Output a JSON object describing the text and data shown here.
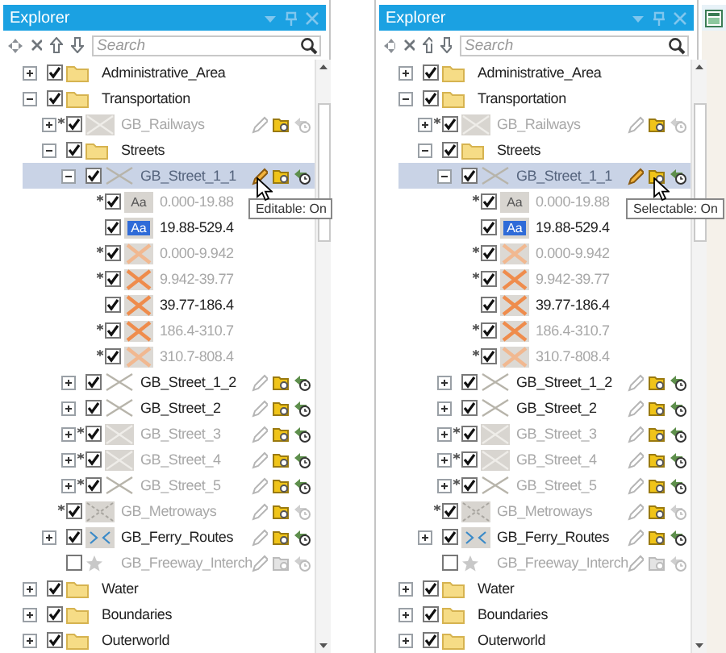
{
  "panels": [
    {
      "title": "Explorer",
      "search": {
        "placeholder": "Search"
      },
      "tooltip": "Editable: On",
      "items": [
        {
          "label": "Administrative_Area",
          "kind": "folder",
          "checked": true,
          "expanded": false
        },
        {
          "label": "Transportation",
          "kind": "folder",
          "checked": true,
          "expanded": true,
          "children": [
            {
              "label": "GB_Railways",
              "kind": "line-box",
              "checked": true,
              "expanded": false,
              "modified": true,
              "dimmed": true,
              "tools": [
                {
                  "kind": "edit",
                  "on": false
                },
                {
                  "kind": "select",
                  "on": true
                },
                {
                  "kind": "snap",
                  "on": false
                }
              ]
            },
            {
              "label": "Streets",
              "kind": "folder",
              "checked": true,
              "expanded": true,
              "children": [
                {
                  "label": "GB_Street_1_1",
                  "kind": "line",
                  "checked": true,
                  "expanded": true,
                  "dimmed": true,
                  "selected": true,
                  "tools": [
                    {
                      "kind": "edit",
                      "on": true,
                      "hovered": true
                    },
                    {
                      "kind": "select",
                      "on": true,
                      "hovered": false
                    },
                    {
                      "kind": "snap",
                      "on": true,
                      "hovered": false
                    }
                  ],
                  "children": [
                    {
                      "label": "0.000-19.88",
                      "kind": "text-grey",
                      "swatch": "Aa",
                      "checked": true,
                      "modified": true,
                      "dimmed": true
                    },
                    {
                      "label": "19.88-529.4",
                      "kind": "text-blue",
                      "swatch": "Aa",
                      "checked": true
                    },
                    {
                      "label": "0.000-9.942",
                      "kind": "x-pale",
                      "checked": true,
                      "modified": true,
                      "dimmed": true
                    },
                    {
                      "label": "9.942-39.77",
                      "kind": "x-orange",
                      "checked": true,
                      "modified": true,
                      "dimmed": true
                    },
                    {
                      "label": "39.77-186.4",
                      "kind": "x-orange",
                      "checked": true
                    },
                    {
                      "label": "186.4-310.7",
                      "kind": "x-orange",
                      "checked": true,
                      "modified": true,
                      "dimmed": true
                    },
                    {
                      "label": "310.7-808.4",
                      "kind": "x-pale",
                      "checked": true,
                      "modified": true,
                      "dimmed": true
                    }
                  ]
                },
                {
                  "label": "GB_Street_1_2",
                  "kind": "line",
                  "checked": true,
                  "expanded": false,
                  "tools": [
                    {
                      "kind": "edit",
                      "on": false
                    },
                    {
                      "kind": "select",
                      "on": true
                    },
                    {
                      "kind": "snap",
                      "on": true
                    }
                  ]
                },
                {
                  "label": "GB_Street_2",
                  "kind": "line",
                  "checked": true,
                  "expanded": false,
                  "tools": [
                    {
                      "kind": "edit",
                      "on": false
                    },
                    {
                      "kind": "select",
                      "on": true
                    },
                    {
                      "kind": "snap",
                      "on": true
                    }
                  ]
                },
                {
                  "label": "GB_Street_3",
                  "kind": "line-box",
                  "checked": true,
                  "expanded": false,
                  "modified": true,
                  "dimmed": true,
                  "tools": [
                    {
                      "kind": "edit",
                      "on": false
                    },
                    {
                      "kind": "select",
                      "on": true
                    },
                    {
                      "kind": "snap",
                      "on": true
                    }
                  ]
                },
                {
                  "label": "GB_Street_4",
                  "kind": "line-box",
                  "checked": true,
                  "expanded": false,
                  "modified": true,
                  "dimmed": true,
                  "tools": [
                    {
                      "kind": "edit",
                      "on": false
                    },
                    {
                      "kind": "select",
                      "on": true
                    },
                    {
                      "kind": "snap",
                      "on": true
                    }
                  ]
                },
                {
                  "label": "GB_Street_5",
                  "kind": "line",
                  "checked": true,
                  "expanded": false,
                  "modified": true,
                  "dimmed": true,
                  "tools": [
                    {
                      "kind": "edit",
                      "on": false
                    },
                    {
                      "kind": "select",
                      "on": true
                    },
                    {
                      "kind": "snap",
                      "on": true
                    }
                  ]
                }
              ]
            },
            {
              "label": "GB_Metroways",
              "kind": "metro",
              "checked": true,
              "modified": true,
              "dimmed": true,
              "tools": [
                {
                  "kind": "edit",
                  "on": false
                },
                {
                  "kind": "select",
                  "on": true
                },
                {
                  "kind": "snap",
                  "on": false
                }
              ]
            },
            {
              "label": "GB_Ferry_Routes",
              "kind": "ferry",
              "checked": true,
              "expanded": false,
              "tools": [
                {
                  "kind": "edit",
                  "on": false
                },
                {
                  "kind": "select",
                  "on": true
                },
                {
                  "kind": "snap",
                  "on": true
                }
              ]
            },
            {
              "label": "GB_Freeway_Interch",
              "kind": "star",
              "checked": false,
              "dimmed": true,
              "tools": [
                {
                  "kind": "edit",
                  "on": false
                },
                {
                  "kind": "select",
                  "on": false
                },
                {
                  "kind": "snap",
                  "on": false
                }
              ]
            }
          ]
        },
        {
          "label": "Water",
          "kind": "folder",
          "checked": true,
          "expanded": false
        },
        {
          "label": "Boundaries",
          "kind": "folder",
          "checked": true,
          "expanded": false
        },
        {
          "label": "Outerworld",
          "kind": "folder",
          "checked": true,
          "expanded": false
        }
      ]
    },
    {
      "title": "Explorer",
      "search": {
        "placeholder": "Search"
      },
      "tooltip": "Selectable: On",
      "items": [
        {
          "label": "Administrative_Area",
          "kind": "folder",
          "checked": true,
          "expanded": false
        },
        {
          "label": "Transportation",
          "kind": "folder",
          "checked": true,
          "expanded": true,
          "children": [
            {
              "label": "GB_Railways",
              "kind": "line-box",
              "checked": true,
              "expanded": false,
              "modified": true,
              "dimmed": true,
              "tools": [
                {
                  "kind": "edit",
                  "on": false
                },
                {
                  "kind": "select",
                  "on": true
                },
                {
                  "kind": "snap",
                  "on": false
                }
              ]
            },
            {
              "label": "Streets",
              "kind": "folder",
              "checked": true,
              "expanded": true,
              "children": [
                {
                  "label": "GB_Street_1_1",
                  "kind": "line",
                  "checked": true,
                  "expanded": true,
                  "dimmed": true,
                  "selected": true,
                  "tools": [
                    {
                      "kind": "edit",
                      "on": true,
                      "hovered": false
                    },
                    {
                      "kind": "select",
                      "on": true,
                      "hovered": true
                    },
                    {
                      "kind": "snap",
                      "on": true,
                      "hovered": false
                    }
                  ],
                  "children": [
                    {
                      "label": "0.000-19.88",
                      "kind": "text-grey",
                      "swatch": "Aa",
                      "checked": true,
                      "modified": true,
                      "dimmed": true
                    },
                    {
                      "label": "19.88-529.4",
                      "kind": "text-blue",
                      "swatch": "Aa",
                      "checked": true
                    },
                    {
                      "label": "0.000-9.942",
                      "kind": "x-pale",
                      "checked": true,
                      "modified": true,
                      "dimmed": true
                    },
                    {
                      "label": "9.942-39.77",
                      "kind": "x-orange",
                      "checked": true,
                      "modified": true,
                      "dimmed": true
                    },
                    {
                      "label": "39.77-186.4",
                      "kind": "x-orange",
                      "checked": true
                    },
                    {
                      "label": "186.4-310.7",
                      "kind": "x-orange",
                      "checked": true,
                      "modified": true,
                      "dimmed": true
                    },
                    {
                      "label": "310.7-808.4",
                      "kind": "x-pale",
                      "checked": true,
                      "modified": true,
                      "dimmed": true
                    }
                  ]
                },
                {
                  "label": "GB_Street_1_2",
                  "kind": "line",
                  "checked": true,
                  "expanded": false,
                  "tools": [
                    {
                      "kind": "edit",
                      "on": false
                    },
                    {
                      "kind": "select",
                      "on": true
                    },
                    {
                      "kind": "snap",
                      "on": true
                    }
                  ]
                },
                {
                  "label": "GB_Street_2",
                  "kind": "line",
                  "checked": true,
                  "expanded": false,
                  "tools": [
                    {
                      "kind": "edit",
                      "on": false
                    },
                    {
                      "kind": "select",
                      "on": true
                    },
                    {
                      "kind": "snap",
                      "on": true
                    }
                  ]
                },
                {
                  "label": "GB_Street_3",
                  "kind": "line-box",
                  "checked": true,
                  "expanded": false,
                  "modified": true,
                  "dimmed": true,
                  "tools": [
                    {
                      "kind": "edit",
                      "on": false
                    },
                    {
                      "kind": "select",
                      "on": true
                    },
                    {
                      "kind": "snap",
                      "on": true
                    }
                  ]
                },
                {
                  "label": "GB_Street_4",
                  "kind": "line-box",
                  "checked": true,
                  "expanded": false,
                  "modified": true,
                  "dimmed": true,
                  "tools": [
                    {
                      "kind": "edit",
                      "on": false
                    },
                    {
                      "kind": "select",
                      "on": true
                    },
                    {
                      "kind": "snap",
                      "on": true
                    }
                  ]
                },
                {
                  "label": "GB_Street_5",
                  "kind": "line",
                  "checked": true,
                  "expanded": false,
                  "modified": true,
                  "dimmed": true,
                  "tools": [
                    {
                      "kind": "edit",
                      "on": false
                    },
                    {
                      "kind": "select",
                      "on": true
                    },
                    {
                      "kind": "snap",
                      "on": true
                    }
                  ]
                }
              ]
            },
            {
              "label": "GB_Metroways",
              "kind": "metro",
              "checked": true,
              "modified": true,
              "dimmed": true,
              "tools": [
                {
                  "kind": "edit",
                  "on": false
                },
                {
                  "kind": "select",
                  "on": true
                },
                {
                  "kind": "snap",
                  "on": false
                }
              ]
            },
            {
              "label": "GB_Ferry_Routes",
              "kind": "ferry",
              "checked": true,
              "expanded": false,
              "tools": [
                {
                  "kind": "edit",
                  "on": false
                },
                {
                  "kind": "select",
                  "on": true
                },
                {
                  "kind": "snap",
                  "on": true
                }
              ]
            },
            {
              "label": "GB_Freeway_Interch",
              "kind": "star",
              "checked": false,
              "dimmed": true,
              "tools": [
                {
                  "kind": "edit",
                  "on": false
                },
                {
                  "kind": "select",
                  "on": false
                },
                {
                  "kind": "snap",
                  "on": false
                }
              ]
            }
          ]
        },
        {
          "label": "Water",
          "kind": "folder",
          "checked": true,
          "expanded": false
        },
        {
          "label": "Boundaries",
          "kind": "folder",
          "checked": true,
          "expanded": false
        },
        {
          "label": "Outerworld",
          "kind": "folder",
          "checked": true,
          "expanded": false
        }
      ]
    }
  ]
}
